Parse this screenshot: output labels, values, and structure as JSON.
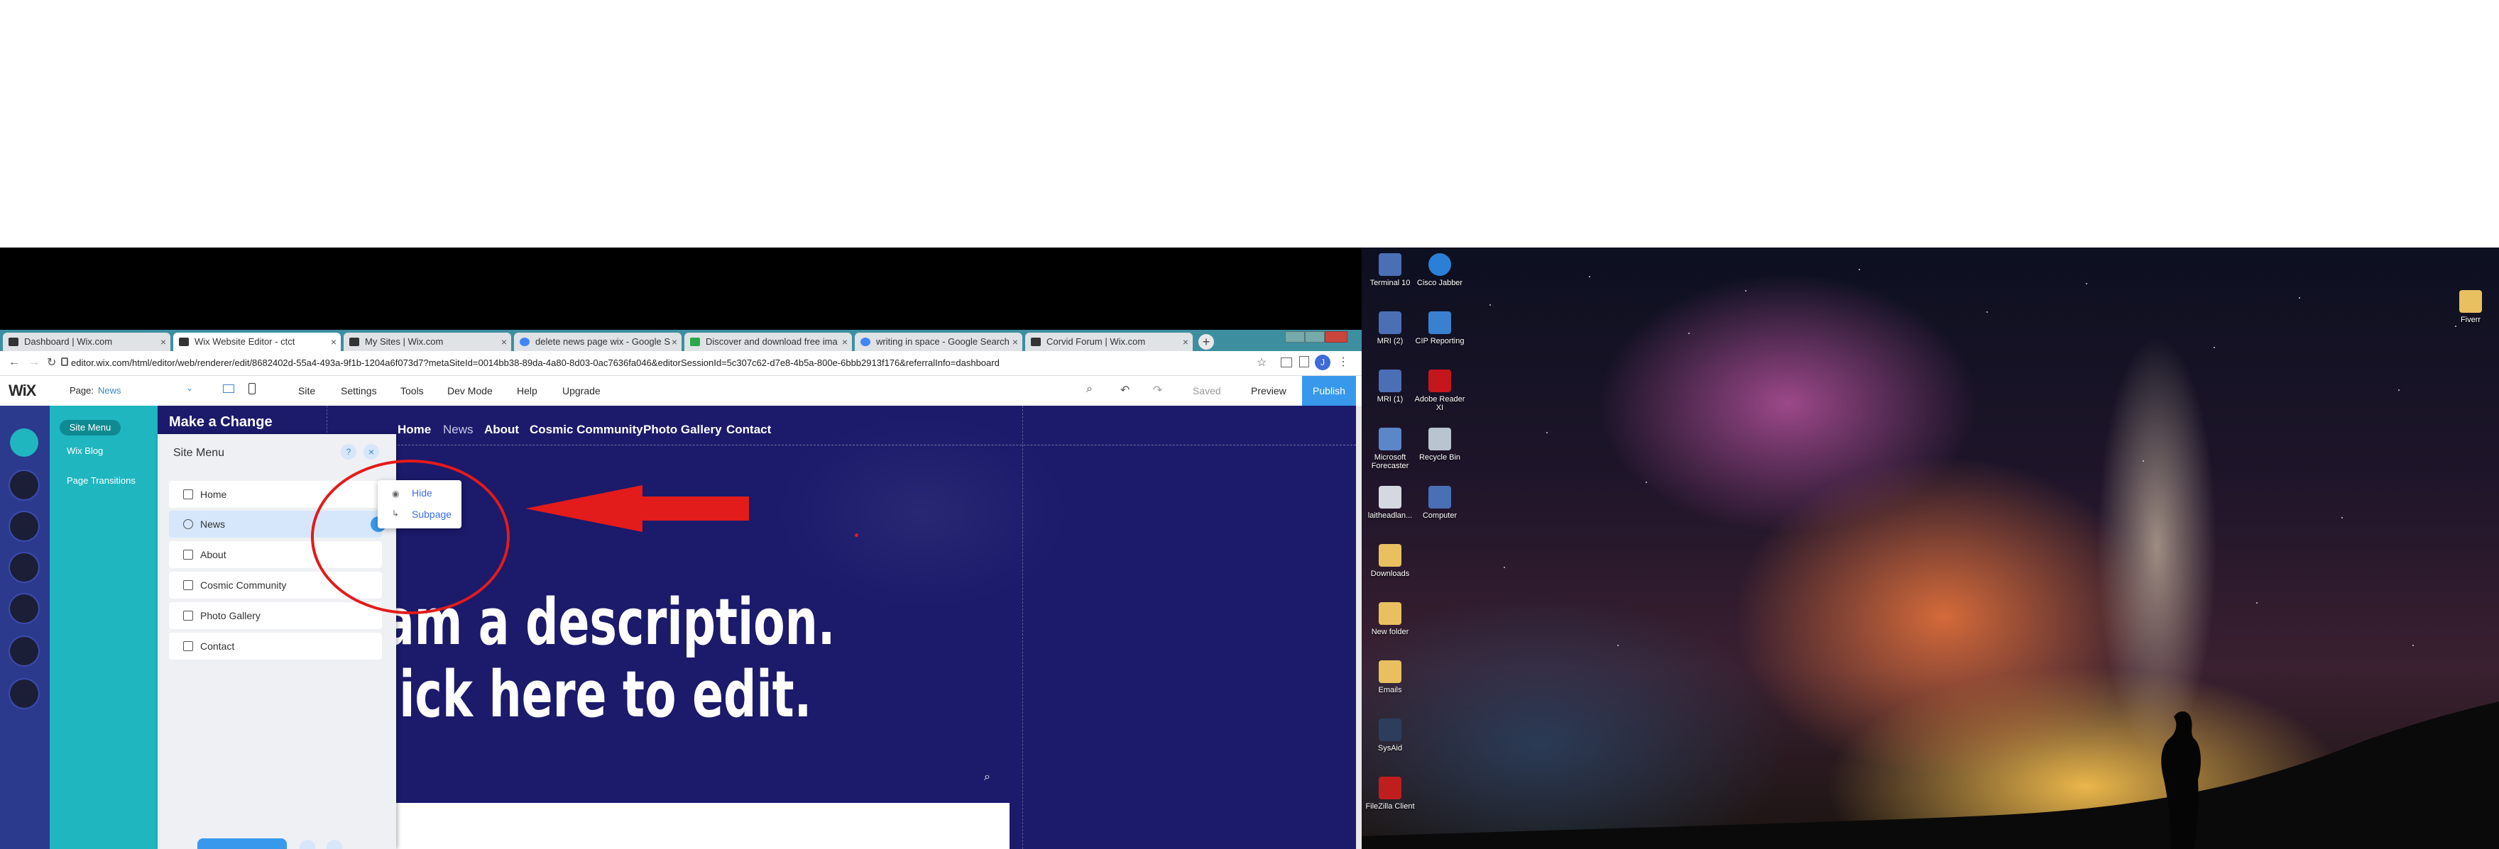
{
  "browser": {
    "tabs": [
      {
        "label": "Dashboard | Wix.com",
        "active": false
      },
      {
        "label": "Wix Website Editor - ctct",
        "active": true
      },
      {
        "label": "My Sites | Wix.com",
        "active": false
      },
      {
        "label": "delete news page wix - Google S",
        "active": false
      },
      {
        "label": "Discover and download free ima",
        "active": false
      },
      {
        "label": "writing in space - Google Search",
        "active": false
      },
      {
        "label": "Corvid Forum | Wix.com",
        "active": false
      }
    ],
    "new_tab_label": "+",
    "url": "editor.wix.com/html/editor/web/renderer/edit/8682402d-55a4-493a-9f1b-1204a6f073d7?metaSiteId=0014bb38-89da-4a80-8d03-0ac7636fa046&editorSessionId=5c307c62-d7e8-4b5a-800e-6bbb2913f176&referralInfo=dashboard",
    "avatar_letter": "J"
  },
  "wix": {
    "logo": "WiX",
    "page_label": "Page:",
    "page_value": "News",
    "menu": [
      "Site",
      "Settings",
      "Tools",
      "Dev Mode",
      "Help",
      "Upgrade"
    ],
    "saved": "Saved",
    "preview": "Preview",
    "publish": "Publish"
  },
  "panel": {
    "sub_items": [
      "Site Menu",
      "Wix Blog",
      "Page Transitions"
    ],
    "title": "Site Menu",
    "help": "?",
    "close": "×",
    "pages": [
      "Home",
      "News",
      "About",
      "Cosmic Community",
      "Photo Gallery",
      "Contact"
    ],
    "context_menu": [
      "Hide",
      "Subpage"
    ]
  },
  "site": {
    "brand": "Make a Change",
    "nav": [
      "Home",
      "News",
      "About",
      "Cosmic Community",
      "Photo Gallery",
      "Contact"
    ],
    "hero_line1": "am a description.",
    "hero_line2": "lick here to edit."
  },
  "desktop": {
    "icons": [
      "Terminal 10",
      "Cisco Jabber",
      "MRI (2)",
      "CIP Reporting",
      "MRI (1)",
      "Adobe Reader XI",
      "Microsoft Forecaster",
      "Recycle Bin",
      "laitheadlan...",
      "Computer",
      "Downloads",
      "New folder",
      "Emails",
      "SysAid",
      "FileZilla Client",
      "Fiverr"
    ]
  },
  "colors": {
    "canvas_bg": "#1b1a6b",
    "wix_teal": "#1fb6c0",
    "publish_blue": "#3899ec",
    "annotation_red": "#e21b1b"
  }
}
